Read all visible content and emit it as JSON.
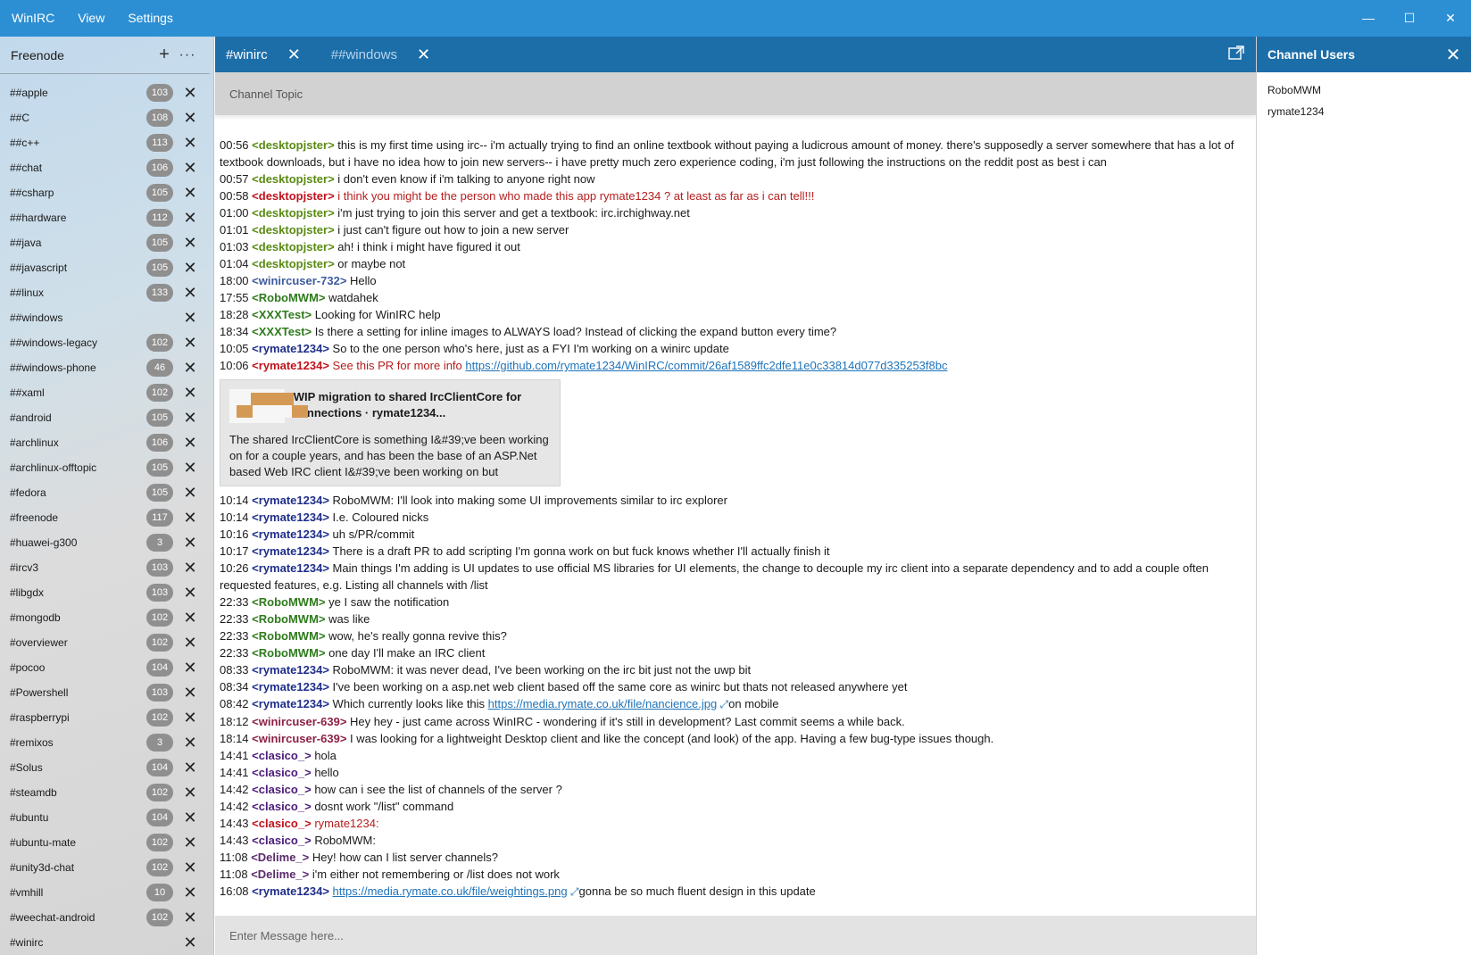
{
  "app": {
    "title": "WinIRC",
    "menu": [
      "View",
      "Settings"
    ],
    "window_controls": {
      "minimize": "—",
      "maximize": "☐",
      "close": "✕"
    }
  },
  "sidebar": {
    "server_name": "Freenode",
    "add_label": "+",
    "more_label": "···",
    "channels": [
      {
        "name": "##apple",
        "count": "103"
      },
      {
        "name": "##C",
        "count": "108"
      },
      {
        "name": "##c++",
        "count": "113"
      },
      {
        "name": "##chat",
        "count": "106"
      },
      {
        "name": "##csharp",
        "count": "105"
      },
      {
        "name": "##hardware",
        "count": "112"
      },
      {
        "name": "##java",
        "count": "105"
      },
      {
        "name": "##javascript",
        "count": "105"
      },
      {
        "name": "##linux",
        "count": "133"
      },
      {
        "name": "##windows",
        "count": ""
      },
      {
        "name": "##windows-legacy",
        "count": "102"
      },
      {
        "name": "##windows-phone",
        "count": "46"
      },
      {
        "name": "##xaml",
        "count": "102"
      },
      {
        "name": "#android",
        "count": "105"
      },
      {
        "name": "#archlinux",
        "count": "106"
      },
      {
        "name": "#archlinux-offtopic",
        "count": "105"
      },
      {
        "name": "#fedora",
        "count": "105"
      },
      {
        "name": "#freenode",
        "count": "117"
      },
      {
        "name": "#huawei-g300",
        "count": "3"
      },
      {
        "name": "#ircv3",
        "count": "103"
      },
      {
        "name": "#libgdx",
        "count": "103"
      },
      {
        "name": "#mongodb",
        "count": "102"
      },
      {
        "name": "#overviewer",
        "count": "102"
      },
      {
        "name": "#pocoo",
        "count": "104"
      },
      {
        "name": "#Powershell",
        "count": "103"
      },
      {
        "name": "#raspberrypi",
        "count": "102"
      },
      {
        "name": "#remixos",
        "count": "3"
      },
      {
        "name": "#Solus",
        "count": "104"
      },
      {
        "name": "#steamdb",
        "count": "102"
      },
      {
        "name": "#ubuntu",
        "count": "104"
      },
      {
        "name": "#ubuntu-mate",
        "count": "102"
      },
      {
        "name": "#unity3d-chat",
        "count": "102"
      },
      {
        "name": "#vmhill",
        "count": "10"
      },
      {
        "name": "#weechat-android",
        "count": "102"
      },
      {
        "name": "#winirc",
        "count": ""
      }
    ]
  },
  "tabs": [
    {
      "label": "#winirc",
      "active": true
    },
    {
      "label": "##windows",
      "active": false
    }
  ],
  "topic": "Channel Topic",
  "messages": [
    {
      "time": "00:56",
      "nick": "desktopjster",
      "color": "c-green",
      "text": "this is my first time using irc-- i'm actually trying to find an online textbook without paying a ludicrous amount of money. there's supposedly a server somewhere that has a lot of textbook downloads, but i have no idea how to join new servers-- i have pretty much zero experience coding, i'm just following the instructions on the reddit post as best i can"
    },
    {
      "time": "00:57",
      "nick": "desktopjster",
      "color": "c-green",
      "text": "i don't even know if i'm talking to anyone right now"
    },
    {
      "time": "00:58",
      "nick": "desktopjster",
      "color": "c-red",
      "hl": true,
      "text": "i think you might be the person who made this app rymate1234 ? at least as far as i can tell!!!"
    },
    {
      "time": "01:00",
      "nick": "desktopjster",
      "color": "c-green",
      "text": "i'm just trying to join this server and get a textbook: irc.irchighway.net"
    },
    {
      "time": "01:01",
      "nick": "desktopjster",
      "color": "c-green",
      "text": "i just can't figure out how to join a new server"
    },
    {
      "time": "01:03",
      "nick": "desktopjster",
      "color": "c-green",
      "text": "ah! i think i might have figured it out"
    },
    {
      "time": "01:04",
      "nick": "desktopjster",
      "color": "c-green",
      "text": "or maybe not"
    },
    {
      "time": "18:00",
      "nick": "winircuser-732",
      "color": "c-slate",
      "text": "Hello"
    },
    {
      "time": "17:55",
      "nick": "RoboMWM",
      "color": "c-green2",
      "text": "watdahek"
    },
    {
      "time": "18:28",
      "nick": "XXXTest",
      "color": "c-green2",
      "text": "Looking for WinIRC help"
    },
    {
      "time": "18:34",
      "nick": "XXXTest",
      "color": "c-green2",
      "text": "Is there a setting for inline images to ALWAYS load? Instead of clicking the expand button every time?"
    },
    {
      "time": "10:05",
      "nick": "rymate1234",
      "color": "c-navy",
      "text": "So to the one person who's here, just as a FYI I'm working on a winirc update"
    },
    {
      "time": "10:06",
      "nick": "rymate1234",
      "color": "c-red",
      "hl": true,
      "text": "See this PR for more info ",
      "link": "https://github.com/rymate1234/WinIRC/commit/26af1589ffc2dfe11e0c33814d077d335253f8bc"
    },
    {
      "preview": true,
      "title": "WIP migration to shared IrcClientCore for connections · rymate1234...",
      "desc": "The shared IrcClientCore is something I&#39;ve been working on for a couple years, and has been the base of an ASP.Net based Web IRC client I&#39;ve been working on but"
    },
    {
      "time": "10:14",
      "nick": "rymate1234",
      "color": "c-navy",
      "text": "RoboMWM: I'll look into making some UI improvements similar to irc explorer"
    },
    {
      "time": "10:14",
      "nick": "rymate1234",
      "color": "c-navy",
      "text": "I.e. Coloured nicks"
    },
    {
      "time": "10:16",
      "nick": "rymate1234",
      "color": "c-navy",
      "text": "uh s/PR/commit"
    },
    {
      "time": "10:17",
      "nick": "rymate1234",
      "color": "c-navy",
      "text": "There is a draft PR to add scripting I'm gonna work on but fuck knows whether I'll actually finish it"
    },
    {
      "time": "10:26",
      "nick": "rymate1234",
      "color": "c-navy",
      "text": "Main things I'm adding is UI updates to use official MS libraries for UI elements, the change to decouple my irc client into a separate dependency and to add a couple often requested features, e.g. Listing all channels with /list"
    },
    {
      "time": "22:33",
      "nick": "RoboMWM",
      "color": "c-green2",
      "text": "ye I saw the notification"
    },
    {
      "time": "22:33",
      "nick": "RoboMWM",
      "color": "c-green2",
      "text": "was like"
    },
    {
      "time": "22:33",
      "nick": "RoboMWM",
      "color": "c-green2",
      "text": "wow, he's really gonna revive this?"
    },
    {
      "time": "22:33",
      "nick": "RoboMWM",
      "color": "c-green2",
      "text": "one day I'll make an IRC client"
    },
    {
      "time": "08:33",
      "nick": "rymate1234",
      "color": "c-navy",
      "text": "RoboMWM: it was never dead, I've been working on the irc bit just not the uwp bit"
    },
    {
      "time": "08:34",
      "nick": "rymate1234",
      "color": "c-navy",
      "text": "I've been working on a asp.net web client based off the same core as winirc but thats not released anywhere yet"
    },
    {
      "time": "08:42",
      "nick": "rymate1234",
      "color": "c-navy",
      "text": "Which currently looks like this ",
      "link": "https://media.rymate.co.uk/file/nancience.jpg",
      "after": "on mobile"
    },
    {
      "time": "18:12",
      "nick": "winircuser-639",
      "color": "c-maroon",
      "text": "Hey hey - just came across WinIRC - wondering if it's still in development? Last commit seems a while back."
    },
    {
      "time": "18:14",
      "nick": "winircuser-639",
      "color": "c-maroon",
      "text": "I was looking for a lightweight Desktop client and like the concept (and look) of the app. Having a few bug-type issues though."
    },
    {
      "time": "14:41",
      "nick": "clasico_",
      "color": "c-purple",
      "text": "hola"
    },
    {
      "time": "14:41",
      "nick": "clasico_",
      "color": "c-purple",
      "text": "hello"
    },
    {
      "time": "14:42",
      "nick": "clasico_",
      "color": "c-purple",
      "text": "how  can i see the list of channels of the server ?"
    },
    {
      "time": "14:42",
      "nick": "clasico_",
      "color": "c-purple",
      "text": "dosnt work \"/list\" command"
    },
    {
      "time": "14:43",
      "nick": "clasico_",
      "color": "c-red",
      "hl": true,
      "text": "rymate1234:"
    },
    {
      "time": "14:43",
      "nick": "clasico_",
      "color": "c-purple",
      "text": "RoboMWM:"
    },
    {
      "time": "11:08",
      "nick": "Delime_",
      "color": "c-plum",
      "text": "Hey! how can I list server channels?"
    },
    {
      "time": "11:08",
      "nick": "Delime_",
      "color": "c-plum",
      "text": "i'm either not remembering or /list does not work"
    },
    {
      "time": "16:08",
      "nick": "rymate1234",
      "color": "c-navy",
      "text": "",
      "link": "https://media.rymate.co.uk/file/weightings.png",
      "after": "gonna be so much fluent design in this update"
    }
  ],
  "composer": {
    "placeholder": "Enter Message here..."
  },
  "users_panel": {
    "title": "Channel Users",
    "users": [
      "RoboMWM",
      "rymate1234"
    ]
  },
  "colors": {
    "accent": "#2d8fd3",
    "tab_bar": "#1c6ea9",
    "link": "#1e73b9",
    "highlight": "#c1121c"
  }
}
